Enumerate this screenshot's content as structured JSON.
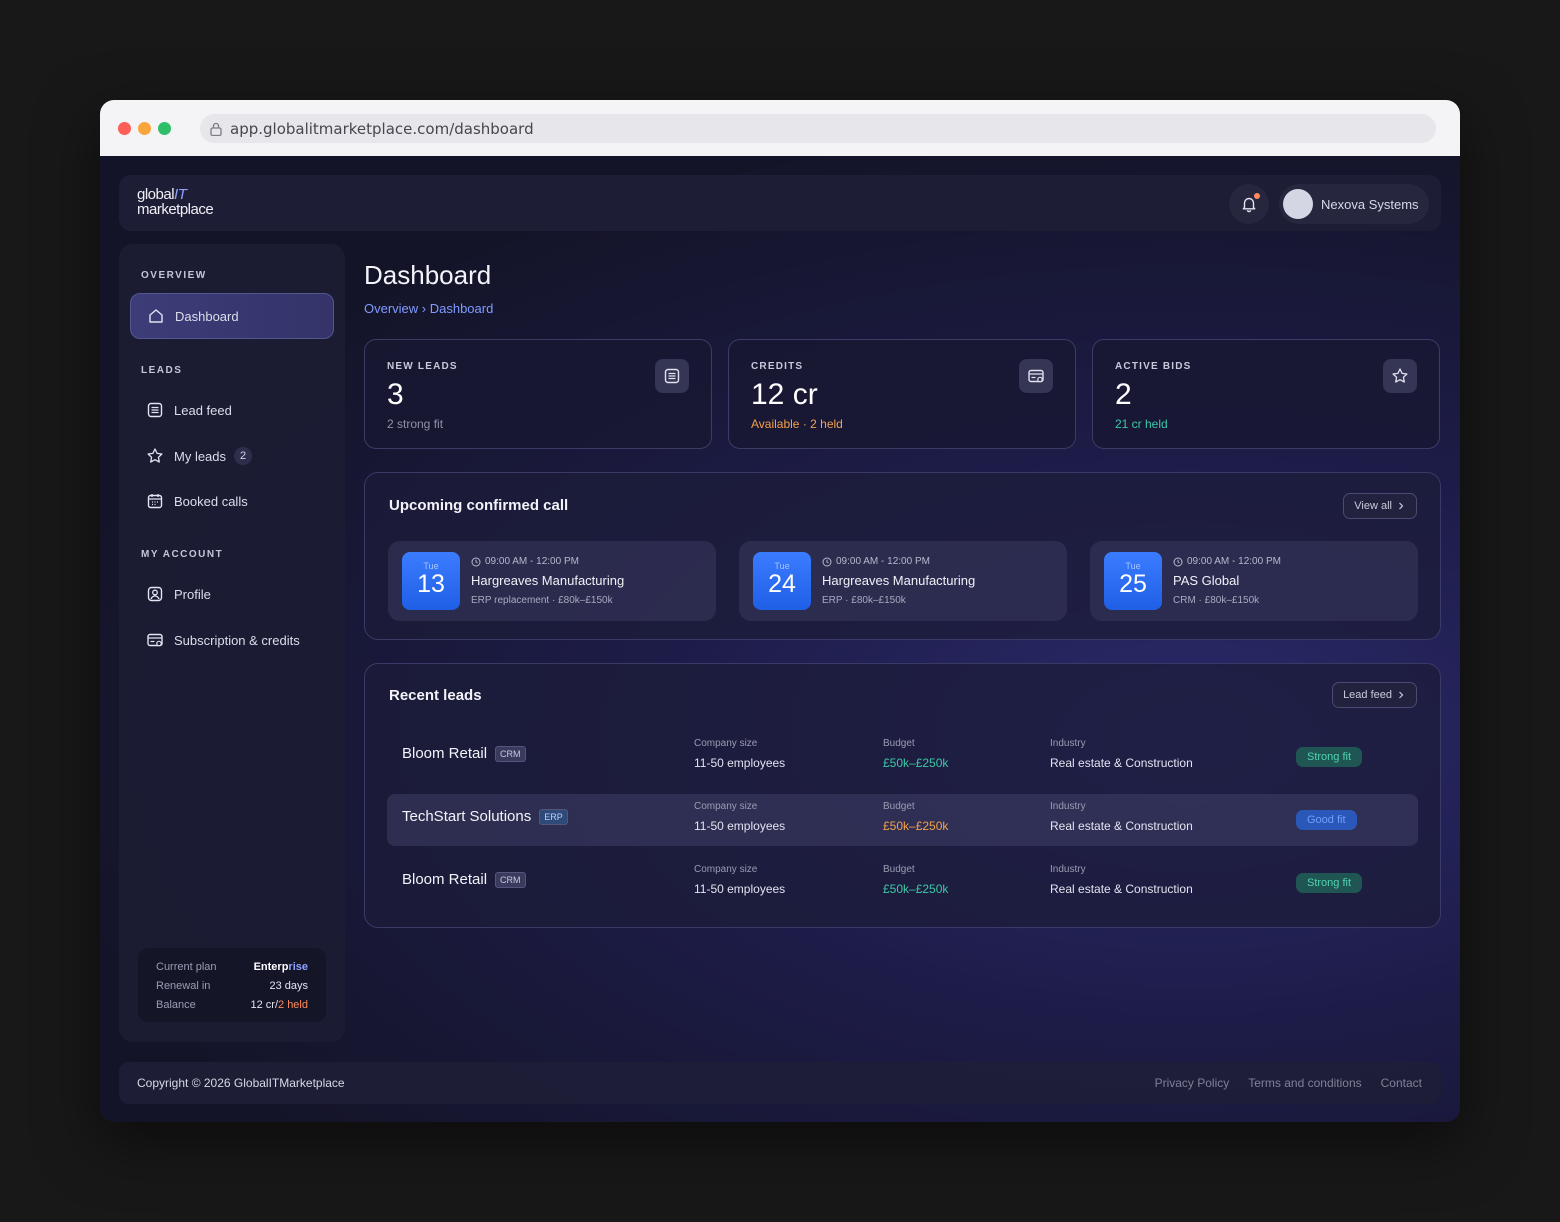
{
  "browser": {
    "url": "app.globalitmarketplace.com/dashboard"
  },
  "brand": {
    "line1": "global",
    "line1_accent": "IT",
    "line2": "marketplace"
  },
  "header": {
    "user_name": "Nexova Systems"
  },
  "sidebar": {
    "overview_title": "OVERVIEW",
    "dashboard": "Dashboard",
    "leads_title": "LEADS",
    "lead_feed": "Lead feed",
    "my_leads": "My leads",
    "my_leads_count": "2",
    "booked_calls": "Booked calls",
    "account_title": "MY ACCOUNT",
    "profile": "Profile",
    "subscription": "Subscription & credits",
    "plan": {
      "plan_label": "Current plan",
      "plan_value_a": "Enterp",
      "plan_value_b": "rise",
      "renewal_label": "Renewal in",
      "renewal_value": "23 days",
      "balance_label": "Balance",
      "balance_value": "12 cr/",
      "balance_held": "2 held"
    }
  },
  "main": {
    "title": "Dashboard",
    "breadcrumb": "Overview › Dashboard",
    "stats": [
      {
        "label": "NEW LEADS",
        "value": "3",
        "sub": "2 strong fit",
        "icon": "list-icon"
      },
      {
        "label": "CREDITS",
        "value": "12 cr",
        "sub": "Available · 2 held",
        "icon": "card-icon"
      },
      {
        "label": "ACTIVE BIDS",
        "value": "2",
        "sub": "21 cr held",
        "icon": "star-icon"
      }
    ],
    "calls": {
      "title": "Upcoming confirmed call",
      "view_all": "View all",
      "items": [
        {
          "dow": "Tue",
          "day": "13",
          "time": "09:00 AM - 12:00 PM",
          "company": "Hargreaves Manufacturing",
          "meta": "ERP replacement · £80k–£150k"
        },
        {
          "dow": "Tue",
          "day": "24",
          "time": "09:00 AM - 12:00 PM",
          "company": "Hargreaves Manufacturing",
          "meta": "ERP · £80k–£150k"
        },
        {
          "dow": "Tue",
          "day": "25",
          "time": "09:00 AM - 12:00 PM",
          "company": "PAS Global",
          "meta": "CRM · £80k–£150k"
        }
      ]
    },
    "leads": {
      "title": "Recent leads",
      "lead_feed": "Lead feed",
      "h_size": "Company size",
      "h_budget": "Budget",
      "h_industry": "Industry",
      "rows": [
        {
          "name": "Bloom Retail",
          "tag": "CRM",
          "size": "11-50 employees",
          "budget": "£50k–£250k",
          "industry": "Real estate & Construction",
          "fit": "Strong fit"
        },
        {
          "name": "TechStart Solutions",
          "tag": "ERP",
          "size": "11-50 employees",
          "budget": "£50k–£250k",
          "industry": "Real estate & Construction",
          "fit": "Good fit"
        },
        {
          "name": "Bloom Retail",
          "tag": "CRM",
          "size": "11-50 employees",
          "budget": "£50k–£250k",
          "industry": "Real estate & Construction",
          "fit": "Strong fit"
        }
      ]
    }
  },
  "footer": {
    "copyright": "Copyright © 2026 GlobalITMarketplace",
    "privacy": "Privacy Policy",
    "terms": "Terms and conditions",
    "contact": "Contact"
  }
}
